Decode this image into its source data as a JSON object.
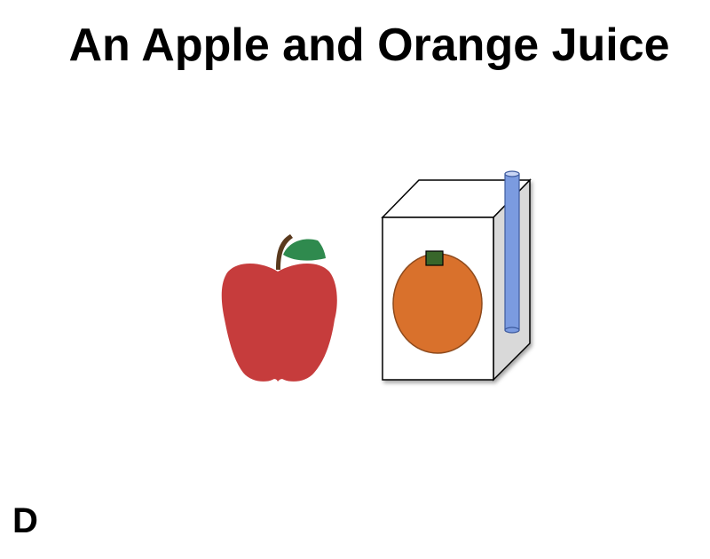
{
  "slide": {
    "title": "An Apple and Orange Juice",
    "corner_label": "D"
  },
  "illustration": {
    "items": [
      {
        "name": "apple",
        "icon": "apple-icon"
      },
      {
        "name": "orange-juice-box",
        "icon": "juice-box-icon"
      }
    ]
  },
  "colors": {
    "apple_red": "#C63C3C",
    "apple_stem": "#5A3A1E",
    "leaf_green": "#2F8A4E",
    "carton_front": "#FFFFFF",
    "carton_side": "#D9D9D9",
    "orange_fill": "#D9712C",
    "orange_outline": "#8E4A1C",
    "orange_stem": "#38662A",
    "straw_blue": "#7B9BE0",
    "straw_outline": "#3D5A9E"
  }
}
